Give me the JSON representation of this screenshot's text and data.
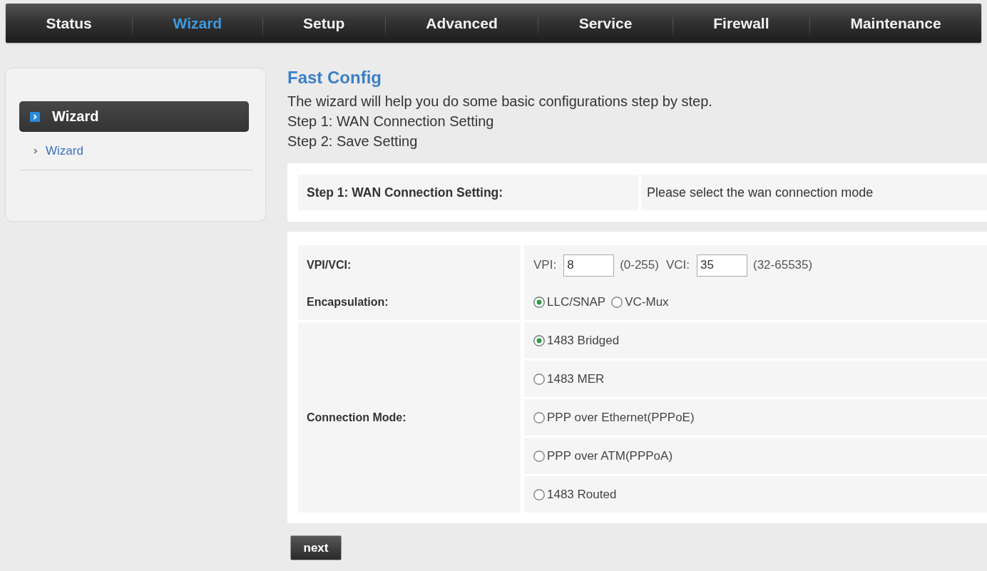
{
  "nav": {
    "tabs": [
      {
        "label": "Status",
        "selected": false
      },
      {
        "label": "Wizard",
        "selected": true
      },
      {
        "label": "Setup",
        "selected": false
      },
      {
        "label": "Advanced",
        "selected": false
      },
      {
        "label": "Service",
        "selected": false
      },
      {
        "label": "Firewall",
        "selected": false
      },
      {
        "label": "Maintenance",
        "selected": false
      }
    ]
  },
  "sidebar": {
    "header": "Wizard",
    "items": [
      {
        "label": "Wizard"
      }
    ]
  },
  "page": {
    "title": "Fast Config",
    "intro": [
      "The wizard will help you do some basic configurations step by step.",
      "Step 1: WAN Connection Setting",
      "Step 2: Save Setting"
    ]
  },
  "step_table": {
    "label": "Step 1: WAN Connection Setting:",
    "hint": "Please select the wan connection mode"
  },
  "form": {
    "vpi_vci": {
      "label": "VPI/VCI:",
      "vpi": {
        "label": "VPI:",
        "value": "8",
        "range": "(0-255)"
      },
      "vci": {
        "label": "VCI:",
        "value": "35",
        "range": "(32-65535)"
      }
    },
    "encapsulation": {
      "label": "Encapsulation:",
      "options": [
        {
          "label": "LLC/SNAP",
          "selected": true
        },
        {
          "label": "VC-Mux",
          "selected": false
        }
      ]
    },
    "connection_mode": {
      "label": "Connection Mode:",
      "options": [
        {
          "label": "1483 Bridged",
          "selected": true
        },
        {
          "label": "1483 MER",
          "selected": false
        },
        {
          "label": "PPP over Ethernet(PPPoE)",
          "selected": false
        },
        {
          "label": "PPP over ATM(PPPoA)",
          "selected": false
        },
        {
          "label": "1483 Routed",
          "selected": false
        }
      ]
    }
  },
  "buttons": [
    {
      "label": "next"
    }
  ]
}
